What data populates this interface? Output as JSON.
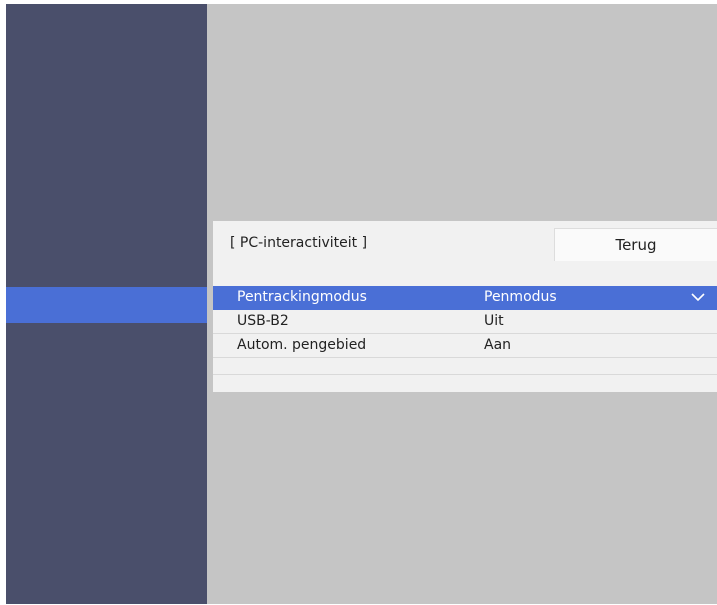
{
  "panel": {
    "title": "[ PC-interactiviteit ]",
    "back_label": "Terug"
  },
  "settings": [
    {
      "label": "Pentrackingmodus",
      "value": "Penmodus",
      "selected": true,
      "has_dropdown": true
    },
    {
      "label": "USB-B2",
      "value": "Uit",
      "selected": false
    },
    {
      "label": "Autom. pengebied",
      "value": "Aan",
      "selected": false
    }
  ],
  "colors": {
    "sidebar": "#4a4f6b",
    "accent": "#4a6fd6",
    "background": "#c5c5c5",
    "panel": "#f1f1f1"
  },
  "icons": {
    "dropdown": "chevron-down-icon"
  }
}
